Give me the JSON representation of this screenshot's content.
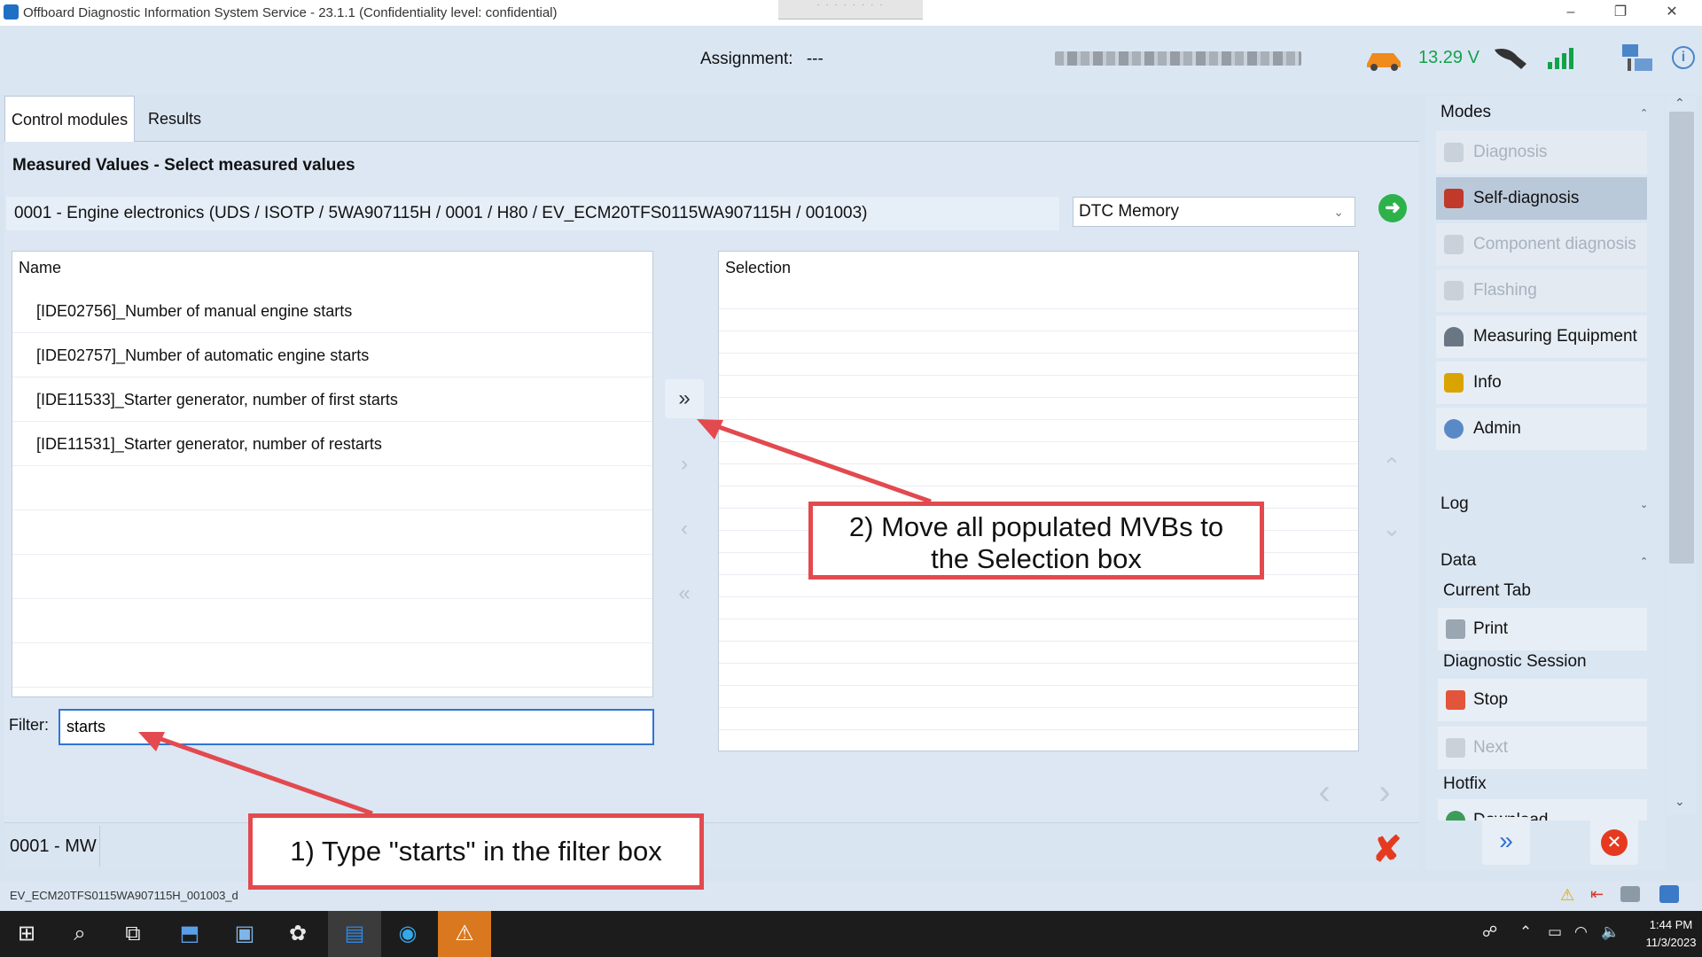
{
  "window": {
    "title": "Offboard Diagnostic Information System Service - 23.1.1 (Confidentiality level: confidential)",
    "controls": [
      "–",
      "❐",
      "✕"
    ]
  },
  "header": {
    "assignment_label": "Assignment:",
    "assignment_value": "---",
    "voltage": "13.29 V",
    "icons": [
      "car-battery-icon",
      "connector-icon",
      "signal-bars-icon",
      "network-icon",
      "info-icon"
    ]
  },
  "tabs": [
    "Control modules",
    "Results"
  ],
  "main": {
    "section_title": "Measured Values - Select measured values",
    "ecu_line": "0001 - Engine electronics  (UDS / ISOTP / 5WA907115H / 0001 / H80 / EV_ECM20TFS0115WA907115H / 001003)",
    "mode_dropdown": "DTC Memory",
    "name_header": "Name",
    "name_rows": [
      "[IDE02756]_Number of manual engine starts",
      "[IDE02757]_Number of automatic engine starts",
      "[IDE11533]_Starter generator, number of first starts",
      "[IDE11531]_Starter generator, number of restarts"
    ],
    "selection_header": "Selection",
    "filter_label": "Filter:",
    "filter_value": "starts",
    "move_buttons": [
      "»",
      "›",
      "‹",
      "«"
    ],
    "footer_label": "0001 - MW"
  },
  "status_bar": {
    "text": "EV_ECM20TFS0115WA907115H_001003_d"
  },
  "right_panel": {
    "modes_title": "Modes",
    "modes": [
      {
        "label": "Diagnosis",
        "state": "disabled",
        "icon": "stethoscope-icon",
        "color": "#c9d1da"
      },
      {
        "label": "Self-diagnosis",
        "state": "selected",
        "icon": "self-diagnosis-icon",
        "color": "#c0392b"
      },
      {
        "label": "Component diagnosis",
        "state": "disabled",
        "icon": "component-icon",
        "color": "#c9d1da"
      },
      {
        "label": "Flashing",
        "state": "disabled",
        "icon": "flash-icon",
        "color": "#c9d1da"
      },
      {
        "label": "Measuring Equipment",
        "state": "normal",
        "icon": "gauge-icon",
        "color": "#6b7684"
      },
      {
        "label": "Info",
        "state": "normal",
        "icon": "books-icon",
        "color": "#d9a400"
      },
      {
        "label": "Admin",
        "state": "normal",
        "icon": "admin-gear-icon",
        "color": "#5a8ac6"
      }
    ],
    "log_title": "Log",
    "data_title": "Data",
    "current_tab_label": "Current Tab",
    "print_label": "Print",
    "diag_session_label": "Diagnostic Session",
    "stop_label": "Stop",
    "next_label": "Next",
    "hotfix_label": "Hotfix",
    "hotfix_item": "Download"
  },
  "callouts": {
    "step1": "1) Type \"starts\" in the filter box",
    "step2_line1": "2) Move all populated MVBs to",
    "step2_line2": "the Selection box"
  },
  "taskbar": {
    "time": "1:44 PM",
    "date": "11/3/2023"
  },
  "colors": {
    "accent_blue": "#2f75d6",
    "callout_red": "#e24a4f",
    "voltage_green": "#13a24a",
    "cancel_red": "#e53a1f"
  }
}
